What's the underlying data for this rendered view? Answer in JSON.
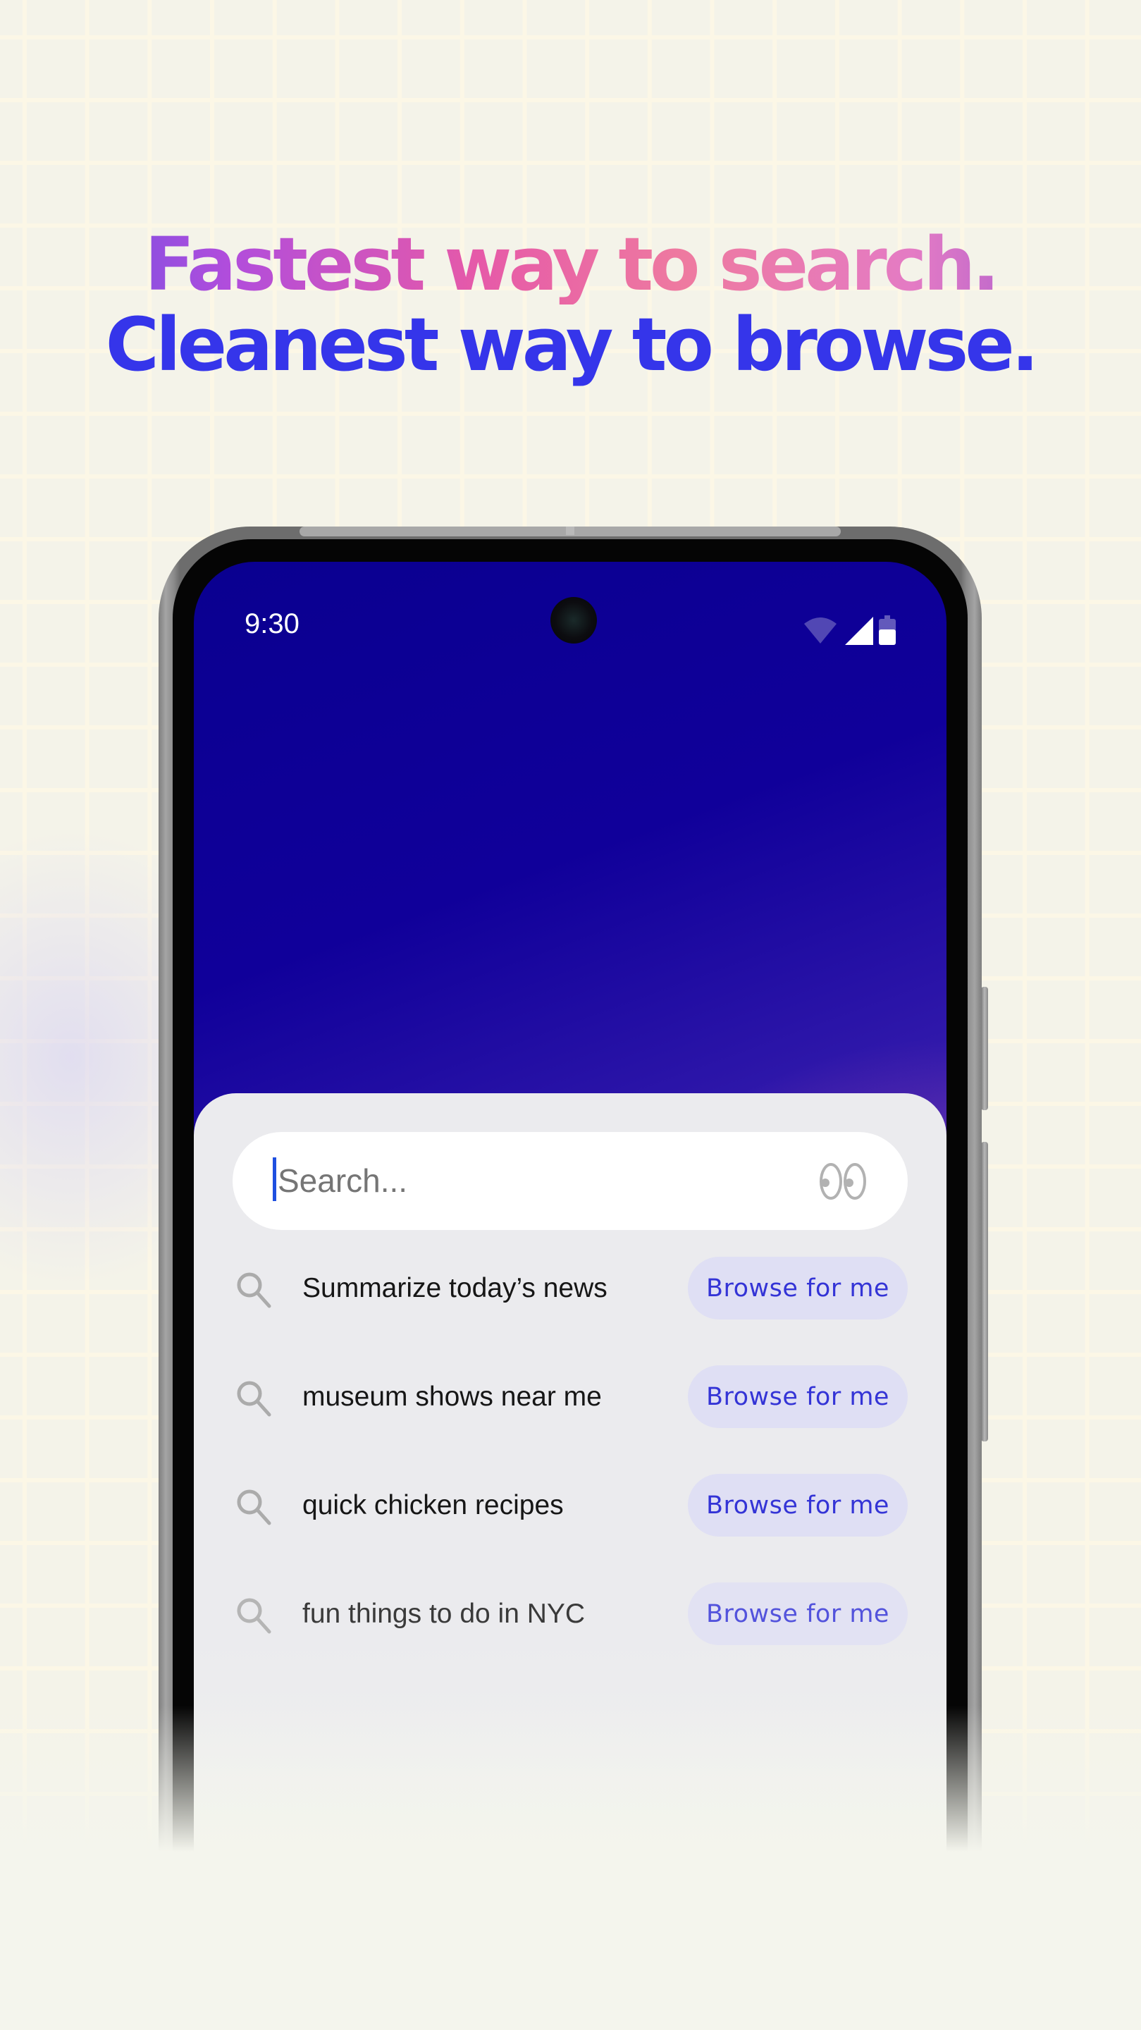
{
  "headline": {
    "line1": "Fastest way to search.",
    "line2": "Cleanest way to browse."
  },
  "colors": {
    "headline_blue": "#3535ea",
    "accent_blue": "#3434d6",
    "button_bg": "#dfdff4",
    "caret": "#1e4fe0",
    "wallpaper_start": "#0a0090",
    "wallpaper_end": "#f8596d"
  },
  "status_bar": {
    "time": "9:30",
    "icons": [
      "wifi-icon",
      "signal-icon",
      "battery-icon"
    ]
  },
  "search": {
    "placeholder": "Search...",
    "value": "",
    "right_icon": "eyes-icon"
  },
  "suggestions": [
    {
      "icon": "search-icon",
      "label": "Summarize today’s news",
      "action": "Browse for me"
    },
    {
      "icon": "search-icon",
      "label": "museum shows near me",
      "action": "Browse for me"
    },
    {
      "icon": "search-icon",
      "label": "quick chicken recipes",
      "action": "Browse for me"
    },
    {
      "icon": "search-icon",
      "label": "fun things to do in NYC",
      "action": "Browse for me"
    }
  ]
}
